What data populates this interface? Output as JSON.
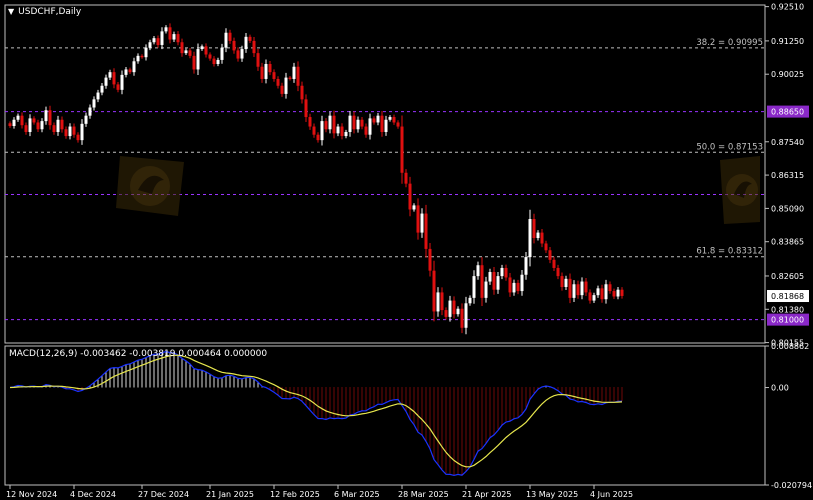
{
  "window": {
    "symbol": "USDCHF,Daily"
  },
  "colors": {
    "background": "#000000",
    "frame": "#c0c0c0",
    "bull": "#ffffff",
    "bear": "#e01010",
    "fib_line": "#c0c0c0",
    "level_line": "#9933ff",
    "level_label_bg": "#8a28c8",
    "macd_line": "#1a33ff",
    "signal_line": "#e6e64d",
    "hist_pos": "#d8d8d8",
    "hist_neg": "#e01010",
    "current_price_bg": "#ffffff"
  },
  "macd_header": {
    "label": "MACD(12,26,9)",
    "values": "-0.003462 -0.003819 0.000464 0.000000"
  },
  "chart_data": [
    {
      "type": "candlestick",
      "title": "USDCHF,Daily",
      "ylim": [
        0.8014,
        0.9257
      ],
      "y_ticks": [
        "0.92510",
        "0.91250",
        "0.90025",
        "0.88650",
        "0.87540",
        "0.86315",
        "0.85090",
        "0.83865",
        "0.82605",
        "0.81868",
        "0.81380",
        "0.81000",
        "0.80155"
      ],
      "current_price": "0.81868",
      "fib_levels": [
        {
          "label": "38.2 = 0.90995",
          "value": 0.90995
        },
        {
          "label": "50.0 = 0.87153",
          "value": 0.87153
        },
        {
          "label": "61.8 = 0.83312",
          "value": 0.83312
        }
      ],
      "horizontal_levels": [
        {
          "label": "0.88650",
          "value": 0.8865
        },
        {
          "label": "0.85600",
          "value": 0.856
        },
        {
          "label": "0.81000",
          "value": 0.81
        }
      ],
      "x_labels": [
        "12 Nov 2024",
        "4 Dec 2024",
        "27 Dec 2024",
        "21 Jan 2025",
        "12 Feb 2025",
        "6 Mar 2025",
        "28 Mar 2025",
        "21 Apr 2025",
        "13 May 2025",
        "4 Jun 2025"
      ],
      "x_label_index": [
        0,
        16,
        33,
        50,
        66,
        82,
        98,
        114,
        130,
        146
      ],
      "close": [
        0.8812,
        0.8835,
        0.885,
        0.8815,
        0.879,
        0.884,
        0.8825,
        0.88,
        0.883,
        0.887,
        0.8815,
        0.879,
        0.8835,
        0.88,
        0.8775,
        0.881,
        0.878,
        0.876,
        0.882,
        0.885,
        0.888,
        0.891,
        0.8935,
        0.896,
        0.899,
        0.901,
        0.8965,
        0.8945,
        0.9,
        0.902,
        0.901,
        0.905,
        0.907,
        0.9065,
        0.91,
        0.912,
        0.9135,
        0.911,
        0.916,
        0.9175,
        0.913,
        0.915,
        0.912,
        0.908,
        0.909,
        0.907,
        0.902,
        0.9095,
        0.9105,
        0.9075,
        0.906,
        0.904,
        0.9055,
        0.91,
        0.9155,
        0.9125,
        0.909,
        0.906,
        0.9095,
        0.914,
        0.9125,
        0.908,
        0.903,
        0.8985,
        0.904,
        0.901,
        0.8985,
        0.896,
        0.893,
        0.899,
        0.8985,
        0.903,
        0.896,
        0.891,
        0.8845,
        0.881,
        0.878,
        0.876,
        0.883,
        0.88,
        0.885,
        0.8785,
        0.881,
        0.8775,
        0.879,
        0.885,
        0.88,
        0.8835,
        0.881,
        0.878,
        0.884,
        0.8825,
        0.885,
        0.879,
        0.8835,
        0.8845,
        0.8825,
        0.881,
        0.864,
        0.86,
        0.8505,
        0.852,
        0.842,
        0.849,
        0.836,
        0.828,
        0.813,
        0.82,
        0.8135,
        0.811,
        0.817,
        0.812,
        0.814,
        0.807,
        0.816,
        0.818,
        0.826,
        0.83,
        0.818,
        0.824,
        0.8275,
        0.821,
        0.826,
        0.829,
        0.8255,
        0.82,
        0.8235,
        0.8205,
        0.8265,
        0.833,
        0.847,
        0.84,
        0.842,
        0.838,
        0.8355,
        0.832,
        0.829,
        0.826,
        0.822,
        0.825,
        0.818,
        0.823,
        0.819,
        0.824,
        0.82,
        0.817,
        0.819,
        0.8215,
        0.8175,
        0.823,
        0.8205,
        0.8185,
        0.821,
        0.8187
      ]
    },
    {
      "type": "macd",
      "title": "MACD(12,26,9)",
      "ylim": [
        -0.020794,
        0.008862
      ],
      "y_ticks": [
        "0.008862",
        "0.00",
        "-0.020794"
      ]
    }
  ]
}
